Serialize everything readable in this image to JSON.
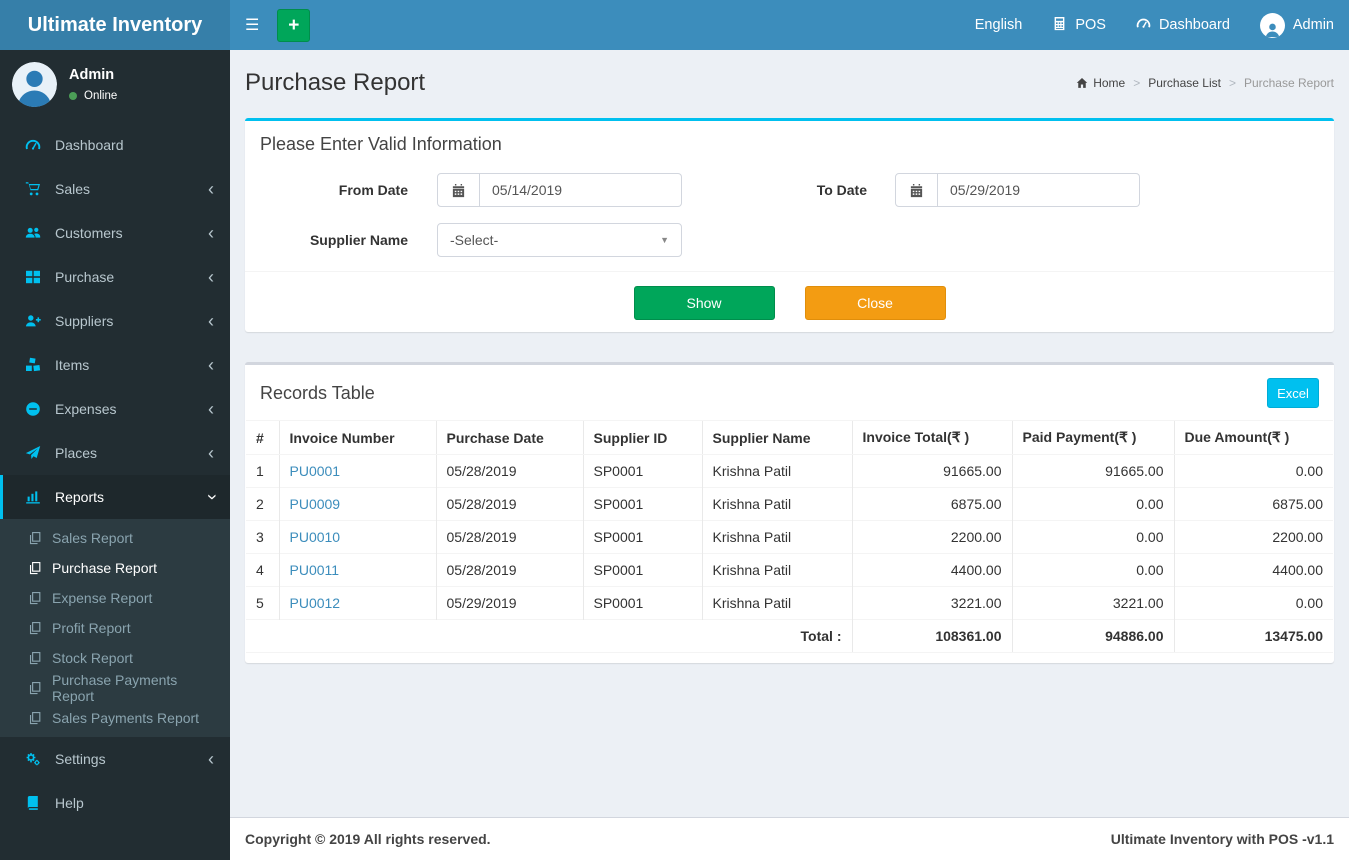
{
  "navbar": {
    "brand": "Ultimate Inventory",
    "items": [
      {
        "label": "English"
      },
      {
        "label": "POS",
        "icon": "calculator-icon"
      },
      {
        "label": "Dashboard",
        "icon": "tachometer-icon"
      },
      {
        "label": "Admin",
        "icon": "user-icon"
      }
    ]
  },
  "sidebar": {
    "user": {
      "name": "Admin",
      "status": "Online"
    },
    "menu": [
      {
        "label": "Dashboard",
        "icon": "dashboard-icon",
        "chevron": "none"
      },
      {
        "label": "Sales",
        "icon": "cart-icon",
        "chevron": "left"
      },
      {
        "label": "Customers",
        "icon": "users-icon",
        "chevron": "left"
      },
      {
        "label": "Purchase",
        "icon": "grid-icon",
        "chevron": "left"
      },
      {
        "label": "Suppliers",
        "icon": "user-plus-icon",
        "chevron": "left"
      },
      {
        "label": "Items",
        "icon": "cubes-icon",
        "chevron": "left"
      },
      {
        "label": "Expenses",
        "icon": "minus-circle-icon",
        "chevron": "left"
      },
      {
        "label": "Places",
        "icon": "paper-plane-icon",
        "chevron": "left"
      },
      {
        "label": "Reports",
        "icon": "bar-chart-icon",
        "chevron": "down",
        "active": true,
        "submenu": [
          {
            "label": "Sales Report",
            "icon": "copy-icon"
          },
          {
            "label": "Purchase Report",
            "icon": "copy-icon",
            "active": true
          },
          {
            "label": "Expense Report",
            "icon": "copy-icon"
          },
          {
            "label": "Profit Report",
            "icon": "copy-icon"
          },
          {
            "label": "Stock Report",
            "icon": "copy-icon"
          },
          {
            "label": "Purchase Payments Report",
            "icon": "copy-icon"
          },
          {
            "label": "Sales Payments Report",
            "icon": "copy-icon"
          }
        ]
      },
      {
        "label": "Settings",
        "icon": "gears-icon",
        "chevron": "left"
      },
      {
        "label": "Help",
        "icon": "book-icon",
        "chevron": "none"
      }
    ]
  },
  "content": {
    "page_title": "Purchase Report"
  },
  "breadcrumb": [
    {
      "label": "Home",
      "icon": "home-icon"
    },
    {
      "label": "Purchase List"
    },
    {
      "label": "Purchase Report",
      "active": true
    }
  ],
  "filter": {
    "title": "Please Enter Valid Information",
    "from_label": "From Date",
    "from_value": "05/14/2019",
    "to_label": "To Date",
    "to_value": "05/29/2019",
    "supplier_label": "Supplier Name",
    "supplier_value": "-Select-",
    "show_label": "Show",
    "close_label": "Close"
  },
  "records": {
    "title": "Records Table",
    "excel_label": "Excel",
    "table": {
      "headers": [
        "#",
        "Invoice Number",
        "Purchase Date",
        "Supplier ID",
        "Supplier Name",
        "Invoice Total(₹ )",
        "Paid Payment(₹ )",
        "Due Amount(₹ )"
      ],
      "numeric_from": 5,
      "rows": [
        [
          "1",
          "PU0001",
          "05/28/2019",
          "SP0001",
          "Krishna Patil",
          "91665.00",
          "91665.00",
          "0.00"
        ],
        [
          "2",
          "PU0009",
          "05/28/2019",
          "SP0001",
          "Krishna Patil",
          "6875.00",
          "0.00",
          "6875.00"
        ],
        [
          "3",
          "PU0010",
          "05/28/2019",
          "SP0001",
          "Krishna Patil",
          "2200.00",
          "0.00",
          "2200.00"
        ],
        [
          "4",
          "PU0011",
          "05/28/2019",
          "SP0001",
          "Krishna Patil",
          "4400.00",
          "0.00",
          "4400.00"
        ],
        [
          "5",
          "PU0012",
          "05/29/2019",
          "SP0001",
          "Krishna Patil",
          "3221.00",
          "3221.00",
          "0.00"
        ]
      ],
      "total_label": "Total :",
      "totals": [
        "108361.00",
        "94886.00",
        "13475.00"
      ]
    }
  },
  "footer": {
    "copyright": "Copyright © 2019 All rights reserved.",
    "version": "Ultimate Inventory with POS -v1.1"
  },
  "colors": {
    "navbar": "#3c8dbc",
    "logo_bg": "#367fa9",
    "sidebar_bg": "#222d32",
    "sidebar_submenu_bg": "#2c3b41",
    "icon_accent": "#00c0ef",
    "show_button": "#00a65a",
    "close_button": "#f39c12",
    "excel_button": "#00c0ef"
  }
}
